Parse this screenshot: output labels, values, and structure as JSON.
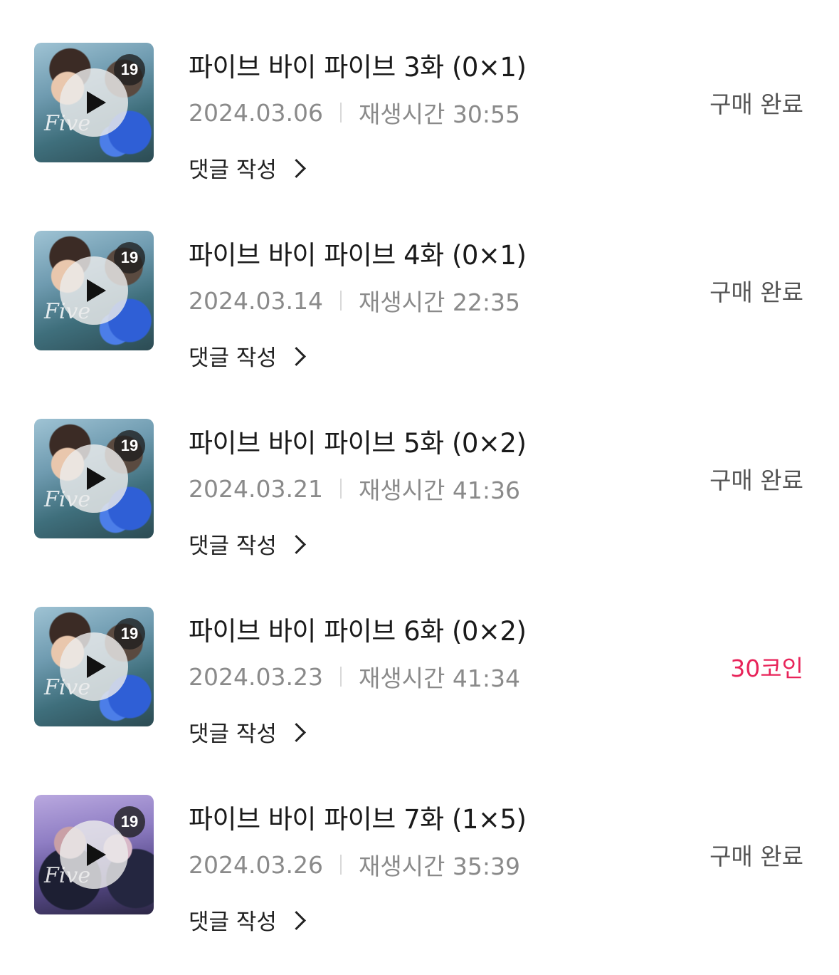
{
  "colors": {
    "status_purchased": "#555555",
    "status_coin": "#e8245a"
  },
  "episodes": [
    {
      "title": "파이브 바이 파이브 3화 (0×1)",
      "date": "2024.03.06",
      "duration": "재생시간 30:55",
      "comment": "댓글 작성",
      "status": "구매 완료",
      "age_badge": "19",
      "thumbnail_art": "five-by-five-cover-a"
    },
    {
      "title": "파이브 바이 파이브 4화 (0×1)",
      "date": "2024.03.14",
      "duration": "재생시간 22:35",
      "comment": "댓글 작성",
      "status": "구매 완료",
      "age_badge": "19",
      "thumbnail_art": "five-by-five-cover-a"
    },
    {
      "title": "파이브 바이 파이브 5화 (0×2)",
      "date": "2024.03.21",
      "duration": "재생시간 41:36",
      "comment": "댓글 작성",
      "status": "구매 완료",
      "age_badge": "19",
      "thumbnail_art": "five-by-five-cover-a"
    },
    {
      "title": "파이브 바이 파이브 6화 (0×2)",
      "date": "2024.03.23",
      "duration": "재생시간 41:34",
      "comment": "댓글 작성",
      "status": "30코인",
      "age_badge": "19",
      "thumbnail_art": "five-by-five-cover-a"
    },
    {
      "title": "파이브 바이 파이브 7화 (1×5)",
      "date": "2024.03.26",
      "duration": "재생시간 35:39",
      "comment": "댓글 작성",
      "status": "구매 완료",
      "age_badge": "19",
      "thumbnail_art": "five-by-five-cover-b"
    }
  ]
}
